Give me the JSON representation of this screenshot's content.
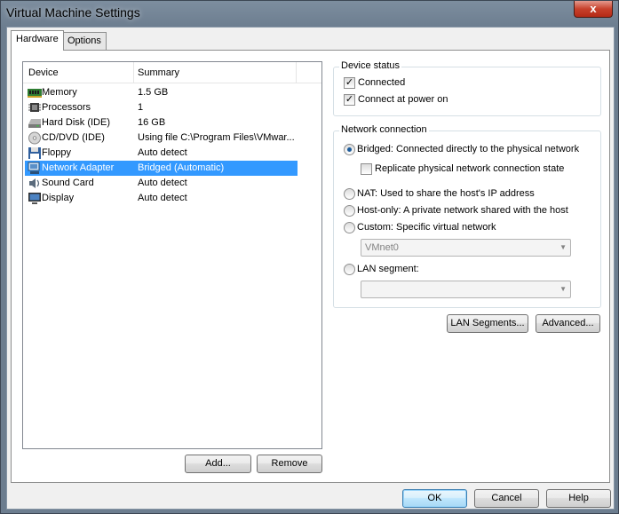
{
  "window": {
    "title": "Virtual Machine Settings",
    "close_glyph": "x"
  },
  "tabs": [
    {
      "label": "Hardware",
      "active": true
    },
    {
      "label": "Options",
      "active": false
    }
  ],
  "device_list": {
    "columns": [
      "Device",
      "Summary"
    ],
    "rows": [
      {
        "device": "Memory",
        "summary": "1.5 GB",
        "icon": "memory-icon"
      },
      {
        "device": "Processors",
        "summary": "1",
        "icon": "processor-icon"
      },
      {
        "device": "Hard Disk (IDE)",
        "summary": "16 GB",
        "icon": "hard-disk-icon"
      },
      {
        "device": "CD/DVD (IDE)",
        "summary": "Using file C:\\Program Files\\VMwar...",
        "icon": "cd-dvd-icon"
      },
      {
        "device": "Floppy",
        "summary": "Auto detect",
        "icon": "floppy-icon"
      },
      {
        "device": "Network Adapter",
        "summary": "Bridged (Automatic)",
        "icon": "network-adapter-icon",
        "selected": true
      },
      {
        "device": "Sound Card",
        "summary": "Auto detect",
        "icon": "sound-card-icon"
      },
      {
        "device": "Display",
        "summary": "Auto detect",
        "icon": "display-icon"
      }
    ]
  },
  "list_buttons": {
    "add": "Add...",
    "remove": "Remove"
  },
  "device_status": {
    "label": "Device status",
    "connected": "Connected",
    "connect_at_power_on": "Connect at power on"
  },
  "network_connection": {
    "label": "Network connection",
    "bridged": "Bridged: Connected directly to the physical network",
    "replicate": "Replicate physical network connection state",
    "nat": "NAT: Used to share the host's IP address",
    "host_only": "Host-only: A private network shared with the host",
    "custom": "Custom: Specific virtual network",
    "custom_value": "VMnet0",
    "lan_segment": "LAN segment:",
    "lan_segment_value": ""
  },
  "network_buttons": {
    "lan_segments": "LAN Segments...",
    "advanced": "Advanced..."
  },
  "footer": {
    "ok": "OK",
    "cancel": "Cancel",
    "help": "Help"
  },
  "check_glyph": "✓",
  "colors": {
    "selection": "#3399ff",
    "title_bar": "#7d8e9f"
  }
}
